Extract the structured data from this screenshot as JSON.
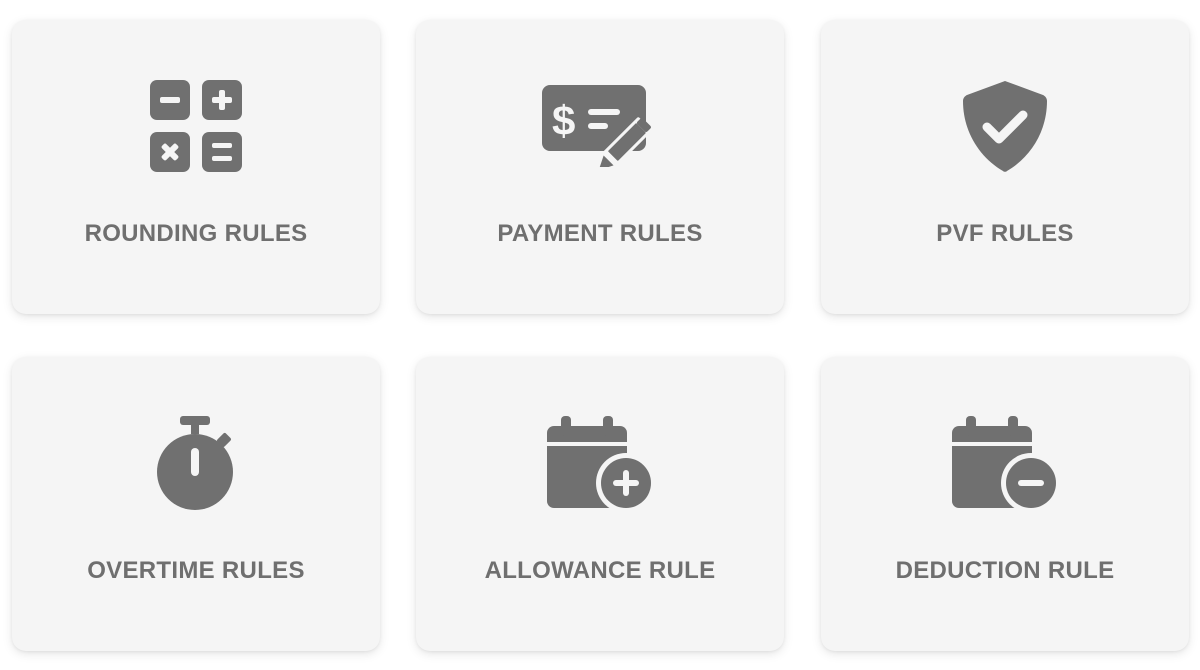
{
  "theme": {
    "card_bg": "#f5f5f5",
    "icon_color": "#707070",
    "label_color": "#6f6f6f"
  },
  "cards": [
    {
      "label": "ROUNDING RULES",
      "icon": "calculator-icon"
    },
    {
      "label": "PAYMENT RULES",
      "icon": "check-edit-icon"
    },
    {
      "label": "PVF RULES",
      "icon": "shield-check-icon"
    },
    {
      "label": "OVERTIME RULES",
      "icon": "stopwatch-icon"
    },
    {
      "label": "ALLOWANCE RULE",
      "icon": "calendar-plus-icon"
    },
    {
      "label": "DEDUCTION RULE",
      "icon": "calendar-minus-icon"
    }
  ]
}
